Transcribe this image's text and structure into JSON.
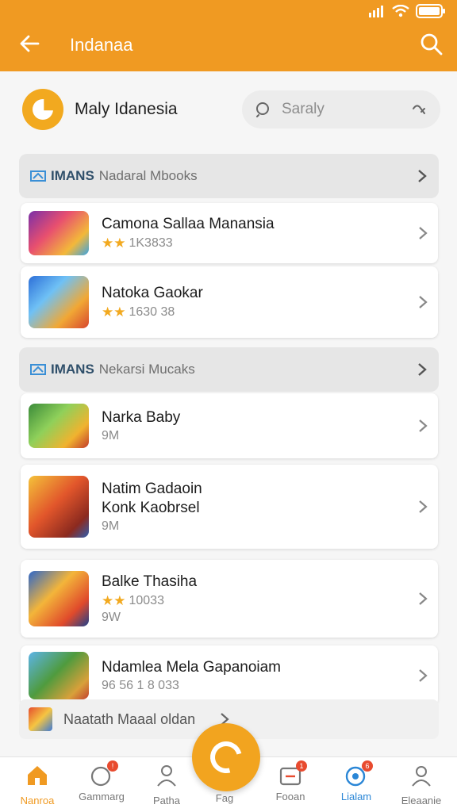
{
  "appbar": {
    "title": "Indanaa"
  },
  "profile": {
    "name": "Maly Idanesia"
  },
  "search": {
    "placeholder": "Saraly"
  },
  "sections": [
    {
      "bold": "IMANS",
      "label": "Nadaral Mbooks"
    },
    {
      "bold": "IMANS",
      "label": "Nekarsi Mucaks"
    }
  ],
  "items": [
    {
      "name": "Camona Sallaa Manansia",
      "meta": "1K3833"
    },
    {
      "name": "Natoka Gaokar",
      "meta": "1630 38"
    },
    {
      "name": "Narka Baby",
      "meta": "9M"
    },
    {
      "name": "Natim Gadaoin",
      "name2": "Konk Kaobrsel",
      "meta": "9M"
    },
    {
      "name": "Balke Thasiha",
      "meta": "10033",
      "meta2": "9W"
    },
    {
      "name": "Ndamlea Mela Gapanoiam",
      "meta": "96 56 1 8 033"
    }
  ],
  "mini_banner": {
    "label": "Naatath Maaal oldan"
  },
  "nav": {
    "items": [
      {
        "label": "Nanroa"
      },
      {
        "label": "Gammarg"
      },
      {
        "label": "Patha"
      },
      {
        "label": "Fag"
      },
      {
        "label": "Fooan"
      },
      {
        "label": "Lialam"
      },
      {
        "label": "Eleaanie"
      }
    ]
  },
  "colors": {
    "accent": "#f09a22",
    "badge": "#e84b2f",
    "star": "#f2a91f"
  }
}
